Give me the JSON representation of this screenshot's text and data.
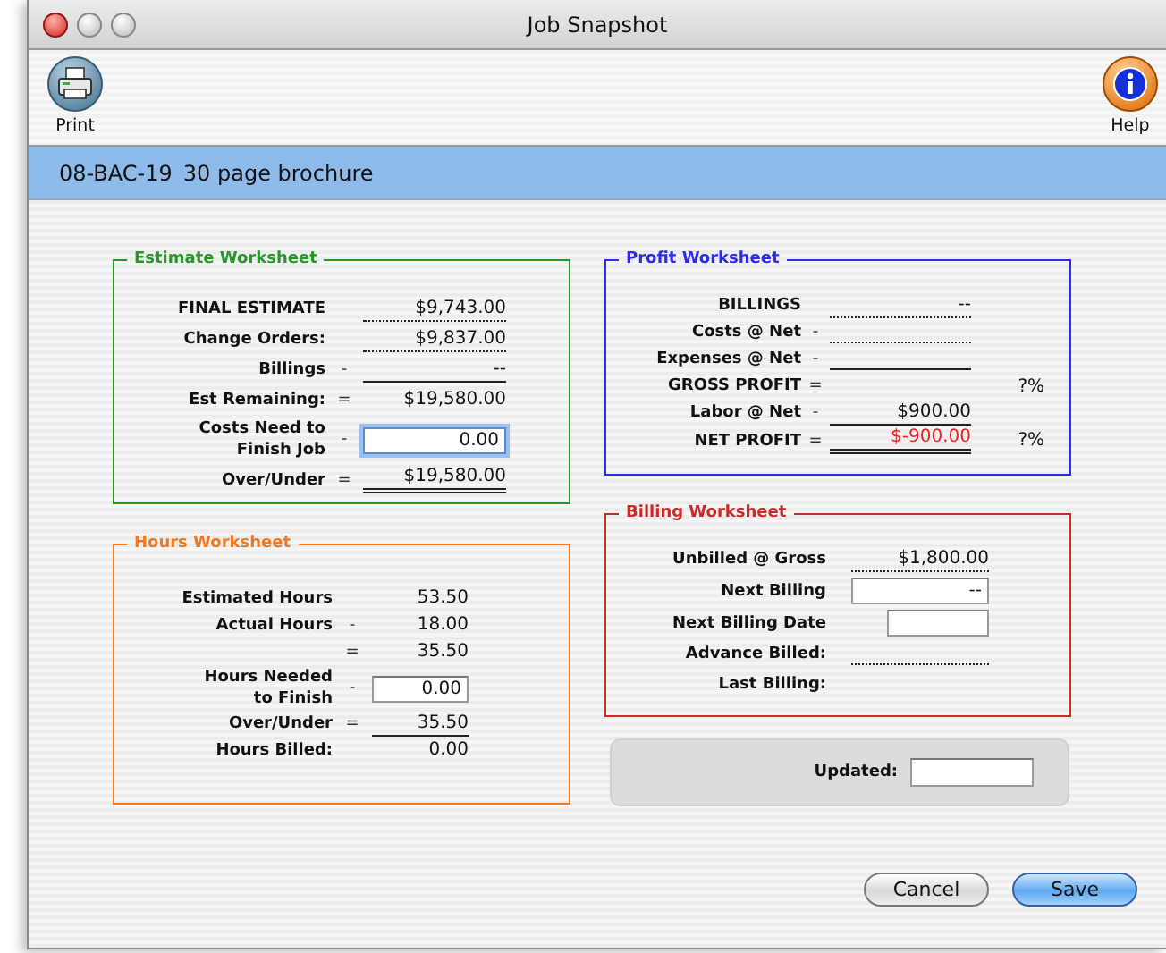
{
  "window": {
    "title": "Job Snapshot"
  },
  "toolbar": [
    {
      "label": "Print",
      "kind": "print"
    },
    {
      "label": "Help",
      "kind": "help"
    }
  ],
  "header": {
    "job_number": "08-BAC-19",
    "description": "30 page brochure"
  },
  "worksheets": [
    {
      "title": "Estimate Worksheet",
      "color": "#2a962a",
      "rows": [
        {
          "label": [
            "FINAL ESTIMATE"
          ],
          "kind": "dotted",
          "value": "$9,743.00"
        },
        {
          "label": [
            "Change Orders:"
          ],
          "kind": "dotted",
          "value": "$9,837.00"
        },
        {
          "label": [
            "Billings"
          ],
          "op": "-",
          "kind": "single",
          "value": "--"
        },
        {
          "label": [
            "Est Remaining:"
          ],
          "op": "=",
          "kind": "plain",
          "value": "$19,580.00"
        },
        {
          "label": [
            "Costs Need to",
            "Finish Job"
          ],
          "op": "-",
          "kind": "input",
          "value": "0.00",
          "focused": true
        },
        {
          "label": [
            "Over/Under"
          ],
          "op": "=",
          "kind": "double",
          "value": "$19,580.00"
        }
      ]
    },
    {
      "title": "Hours Worksheet",
      "color": "#f07a22",
      "rows": [
        {
          "label": [
            "Estimated Hours"
          ],
          "kind": "plain",
          "value": "53.50"
        },
        {
          "label": [
            "Actual Hours"
          ],
          "op": "-",
          "kind": "plain",
          "value": "18.00"
        },
        {
          "op": "=",
          "kind": "plain",
          "value": "35.50"
        },
        {
          "label": [
            "Hours Needed",
            "to Finish"
          ],
          "op": "-",
          "kind": "input",
          "value": "0.00",
          "focused": false
        },
        {
          "label": [
            "Over/Under"
          ],
          "op": "=",
          "kind": "single",
          "value": "35.50"
        },
        {
          "label": [
            "Hours Billed:"
          ],
          "kind": "plain",
          "value": "0.00"
        }
      ]
    },
    {
      "title": "Profit Worksheet",
      "color": "#2c2cf0",
      "rows": [
        {
          "label": [
            "BILLINGS"
          ],
          "kind": "dotted",
          "value": "--",
          "negative": false
        },
        {
          "label": [
            "Costs @ Net"
          ],
          "op": "-",
          "kind": "dotted"
        },
        {
          "label": [
            "Expenses @ Net"
          ],
          "op": "-",
          "kind": "single"
        },
        {
          "label": [
            "GROSS PROFIT"
          ],
          "op": "=",
          "kind": "plain",
          "pct": "?%"
        },
        {
          "label": [
            "Labor @ Net"
          ],
          "op": "-",
          "kind": "single",
          "value": "$900.00",
          "negative": false
        },
        {
          "label": [
            "NET PROFIT"
          ],
          "op": "=",
          "kind": "double",
          "value": "$-900.00",
          "pct": "?%",
          "negative": true
        }
      ]
    },
    {
      "title": "Billing Worksheet",
      "color": "#c82a2a",
      "rows": [
        {
          "label": [
            "Unbilled @ Gross"
          ],
          "kind": "dotted",
          "value": "$1,800.00"
        },
        {
          "label": [
            "Next Billing"
          ],
          "kind": "input",
          "value": "--",
          "focused": false
        },
        {
          "label": [
            "Next Billing Date"
          ],
          "kind": "input_short",
          "focused": false
        },
        {
          "label": [
            "Advance Billed:"
          ],
          "kind": "dotted"
        },
        {
          "label": [
            "Last Billing:"
          ],
          "kind": "plain"
        }
      ]
    }
  ],
  "updated": {
    "label": "Updated:"
  },
  "buttons": [
    {
      "label": "Cancel",
      "default": false
    },
    {
      "label": "Save",
      "default": true
    }
  ]
}
